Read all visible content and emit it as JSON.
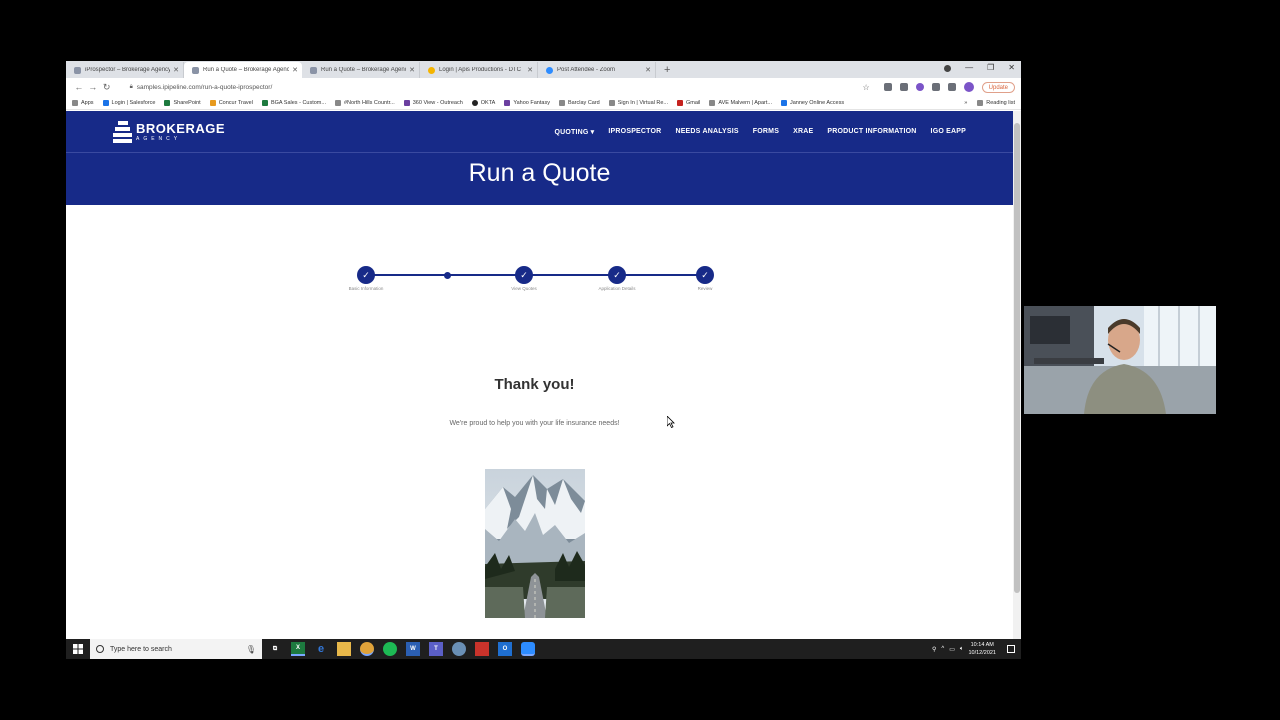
{
  "browser": {
    "tabs": [
      {
        "label": "iProspector – Brokerage Agency",
        "active": false
      },
      {
        "label": "Run a Quote – Brokerage Agency",
        "active": true
      },
      {
        "label": "Run a Quote – Brokerage Agency",
        "active": false
      },
      {
        "label": "Login | Apis Productions - DTC",
        "active": false
      },
      {
        "label": "Post Attendee - Zoom",
        "active": false
      }
    ],
    "new_tab_label": "+",
    "url": "samples.ipipeline.com/run-a-quote-iprospector/",
    "update_label": "Update",
    "bookmarks": [
      {
        "label": "Apps",
        "icon": "apps-icon"
      },
      {
        "label": "Login | Salesforce",
        "icon": "salesforce-icon"
      },
      {
        "label": "SharePoint",
        "icon": "sharepoint-icon"
      },
      {
        "label": "Concur Travel",
        "icon": "concur-icon"
      },
      {
        "label": "BGA Sales - Custom...",
        "icon": "excel-icon"
      },
      {
        "label": "#North Hills Countr...",
        "icon": "cc-icon"
      },
      {
        "label": "360 View - Outreach",
        "icon": "outreach-icon"
      },
      {
        "label": "OKTA",
        "icon": "okta-icon"
      },
      {
        "label": "Yahoo Fantasy",
        "icon": "yahoo-icon"
      },
      {
        "label": "Barclay Card",
        "icon": "barclay-icon"
      },
      {
        "label": "Sign In | Virtual Re...",
        "icon": "virtual-icon"
      },
      {
        "label": "Gmail",
        "icon": "gmail-icon"
      },
      {
        "label": "AVE Malvern | Apart...",
        "icon": "ave-icon"
      },
      {
        "label": "Janney Online Access",
        "icon": "janney-icon"
      }
    ],
    "bookmarks_more": "»",
    "reading_list": "Reading list"
  },
  "site": {
    "logo_main": "BROKERAGE",
    "logo_sub": "AGENCY",
    "nav": [
      "QUOTING ▾",
      "IPROSPECTOR",
      "NEEDS ANALYSIS",
      "FORMS",
      "XRAE",
      "PRODUCT INFORMATION",
      "IGO EAPP"
    ],
    "page_title": "Run a Quote",
    "stepper": {
      "steps": [
        {
          "label": "Basic Information",
          "type": "check"
        },
        {
          "label": "",
          "type": "dot"
        },
        {
          "label": "View Quotes",
          "type": "check"
        },
        {
          "label": "Application Details",
          "type": "check"
        },
        {
          "label": "Review",
          "type": "check"
        }
      ],
      "check_glyph": "✓"
    },
    "thank_you_title": "Thank you!",
    "thank_you_text": "We're proud to help you with your life insurance needs!"
  },
  "taskbar": {
    "search_placeholder": "Type here to search",
    "time": "10:14 AM",
    "date": "10/12/2021"
  },
  "colors": {
    "brand_navy": "#172a88",
    "taskbar": "#1f1f1f"
  }
}
